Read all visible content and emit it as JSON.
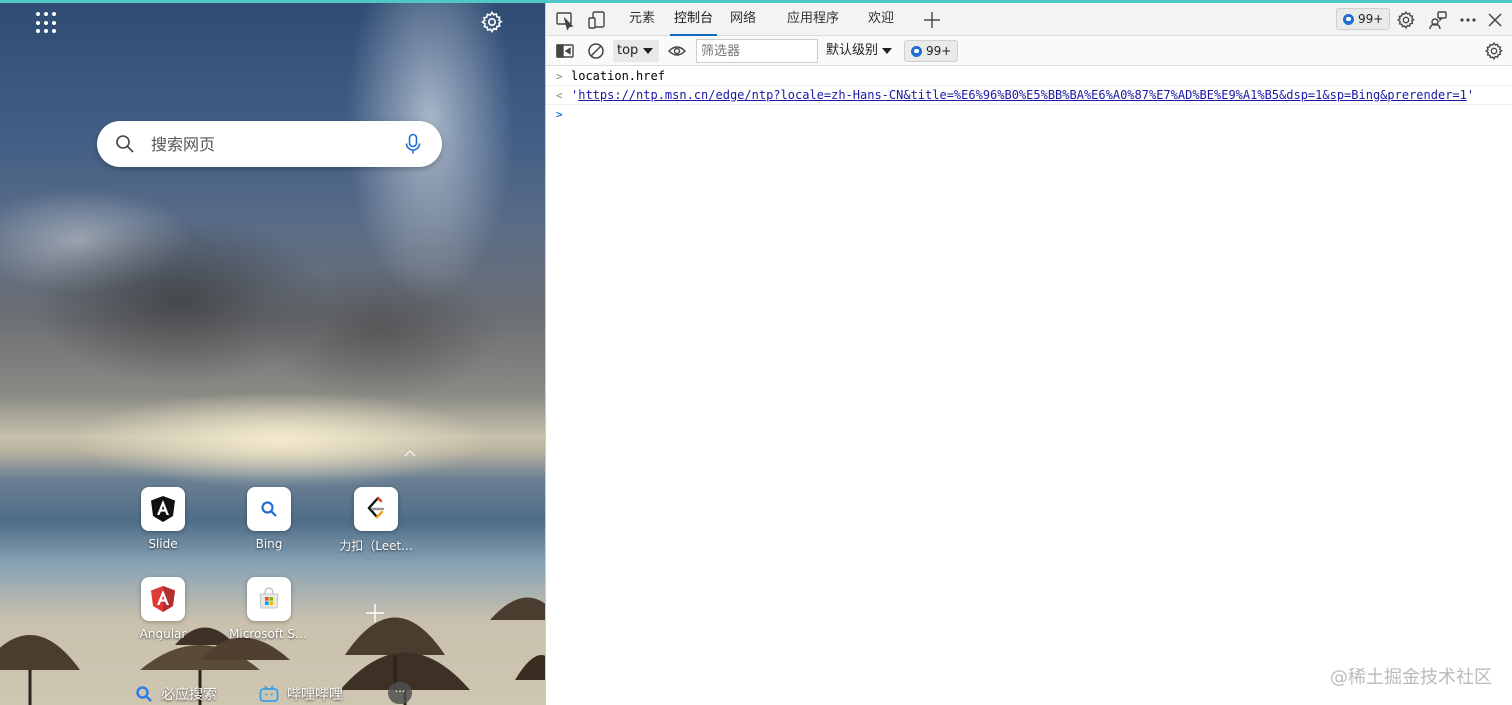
{
  "ntp": {
    "search": {
      "placeholder": "搜索网页"
    },
    "tiles": [
      {
        "label": "Slide",
        "icon": "angular-black-icon"
      },
      {
        "label": "Bing",
        "icon": "bing-search-icon"
      },
      {
        "label": "力扣（Leet...",
        "icon": "leetcode-icon"
      },
      {
        "label": "Angular",
        "icon": "angular-red-icon"
      },
      {
        "label": "Microsoft St...",
        "icon": "microsoft-store-icon"
      }
    ],
    "bottom_links": [
      {
        "label": "必应搜索",
        "icon": "search-icon"
      },
      {
        "label": "哔哩哔哩",
        "icon": "bilibili-icon"
      }
    ],
    "more_label": "···"
  },
  "devtools": {
    "tabs": [
      "元素",
      "控制台",
      "网络",
      "应用程序",
      "欢迎"
    ],
    "active_tab": "控制台",
    "issues_badge": "99+",
    "toolbar": {
      "context": "top",
      "filter_placeholder": "筛选器",
      "level": "默认级别",
      "issues_badge": "99+"
    },
    "console": {
      "input": "location.href",
      "output_quote_open": "'",
      "output_url": "https://ntp.msn.cn/edge/ntp?locale=zh-Hans-CN&title=%E6%96%B0%E5%BB%BA%E6%A0%87%E7%AD%BE%E9%A1%B5&dsp=1&sp=Bing&prerender=1",
      "output_quote_close": "'",
      "input_prefix": ">",
      "output_prefix": "<",
      "prompt_prefix": ">"
    }
  },
  "watermark": "@稀土掘金技术社区",
  "colors": {
    "accent": "#0f6cbd",
    "teal": "#4fc7c4",
    "string": "#1a1aa6"
  }
}
